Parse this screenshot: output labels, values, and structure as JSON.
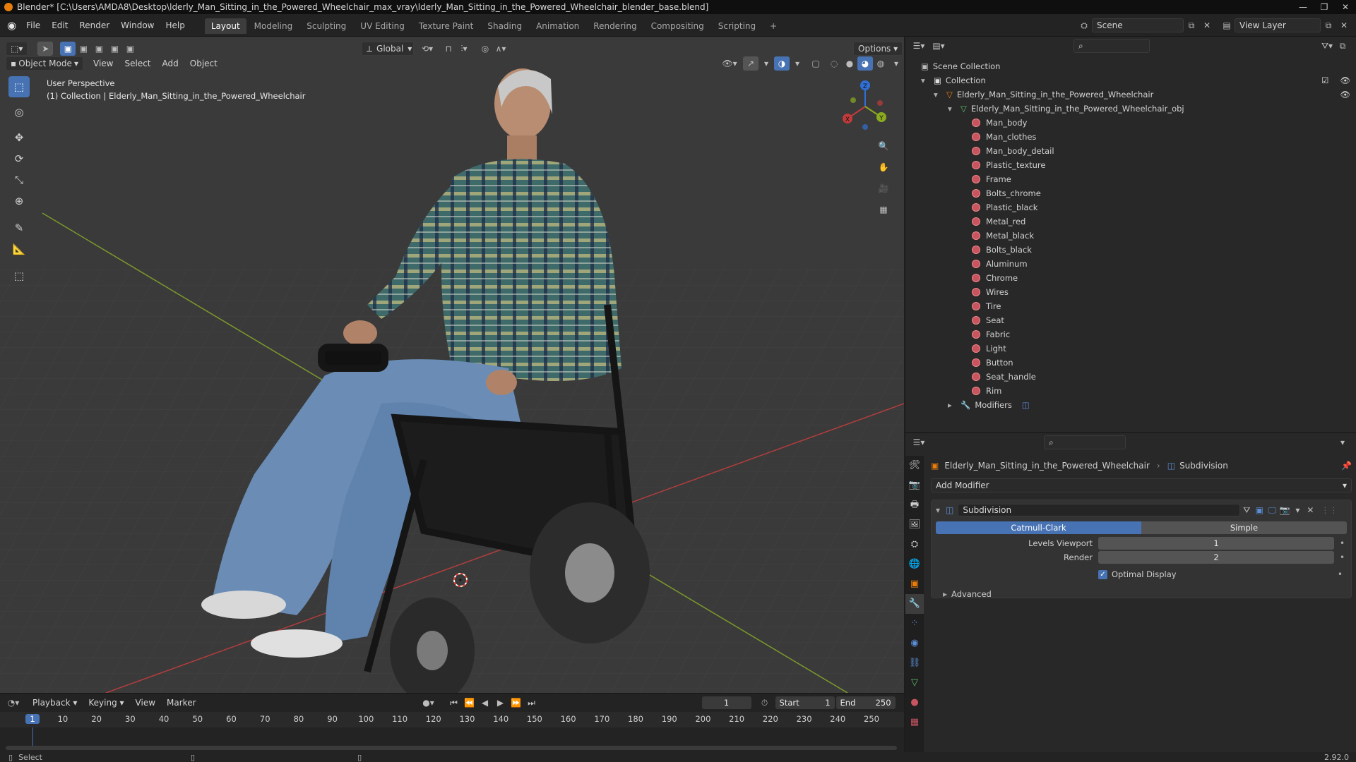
{
  "window": {
    "title": "Blender* [C:\\Users\\AMDA8\\Desktop\\lderly_Man_Sitting_in_the_Powered_Wheelchair_max_vray\\lderly_Man_Sitting_in_the_Powered_Wheelchair_blender_base.blend]",
    "controls": [
      "—",
      "❐",
      "✕"
    ]
  },
  "menu": [
    "File",
    "Edit",
    "Render",
    "Window",
    "Help"
  ],
  "workspaces": [
    "Layout",
    "Modeling",
    "Sculpting",
    "UV Editing",
    "Texture Paint",
    "Shading",
    "Animation",
    "Rendering",
    "Compositing",
    "Scripting",
    "+"
  ],
  "active_workspace": "Layout",
  "scene": {
    "name": "Scene",
    "view_layer": "View Layer"
  },
  "viewport": {
    "mode": "Object Mode",
    "menus": [
      "View",
      "Select",
      "Add",
      "Object"
    ],
    "transform_orientation": "Global",
    "options": "Options",
    "overlay_title": "User Perspective",
    "overlay_subtitle": "(1) Collection | Elderly_Man_Sitting_in_the_Powered_Wheelchair",
    "gizmo": {
      "x": "X",
      "y": "Y",
      "z": "Z"
    }
  },
  "outliner": {
    "search_placeholder": "",
    "scene_collection": "Scene Collection",
    "collection": "Collection",
    "object": "Elderly_Man_Sitting_in_the_Powered_Wheelchair",
    "mesh": "Elderly_Man_Sitting_in_the_Powered_Wheelchair_obj",
    "materials": [
      "Man_body",
      "Man_clothes",
      "Man_body_detail",
      "Plastic_texture",
      "Frame",
      "Bolts_chrome",
      "Plastic_black",
      "Metal_red",
      "Metal_black",
      "Bolts_black",
      "Aluminum",
      "Chrome",
      "Wires",
      "Tire",
      "Seat",
      "Fabric",
      "Light",
      "Button",
      "Seat_handle",
      "Rim"
    ],
    "modifiers": "Modifiers"
  },
  "properties": {
    "breadcrumb_object": "Elderly_Man_Sitting_in_the_Powered_Wheelchair",
    "breadcrumb_modifier": "Subdivision",
    "add_modifier": "Add Modifier",
    "modifier_name": "Subdivision",
    "type_options": [
      "Catmull-Clark",
      "Simple"
    ],
    "levels_viewport_label": "Levels Viewport",
    "levels_viewport": "1",
    "render_label": "Render",
    "render_value": "2",
    "optimal_display": "Optimal Display",
    "advanced": "Advanced"
  },
  "timeline": {
    "menus": [
      "Playback",
      "Keying",
      "View",
      "Marker"
    ],
    "current_frame": "1",
    "start_label": "Start",
    "start": "1",
    "end_label": "End",
    "end": "250",
    "ticks": [
      "1",
      "10",
      "20",
      "30",
      "40",
      "50",
      "60",
      "70",
      "80",
      "90",
      "100",
      "110",
      "120",
      "130",
      "140",
      "150",
      "160",
      "170",
      "180",
      "190",
      "200",
      "210",
      "220",
      "230",
      "240",
      "250"
    ]
  },
  "status": {
    "left": "Select",
    "version": "2.92.0"
  },
  "colors": {
    "accent": "#4772b3",
    "material": "#c85460",
    "object_orange": "#e87d0d",
    "axis_red": "#c13b3b",
    "axis_green": "#8aab1f"
  }
}
